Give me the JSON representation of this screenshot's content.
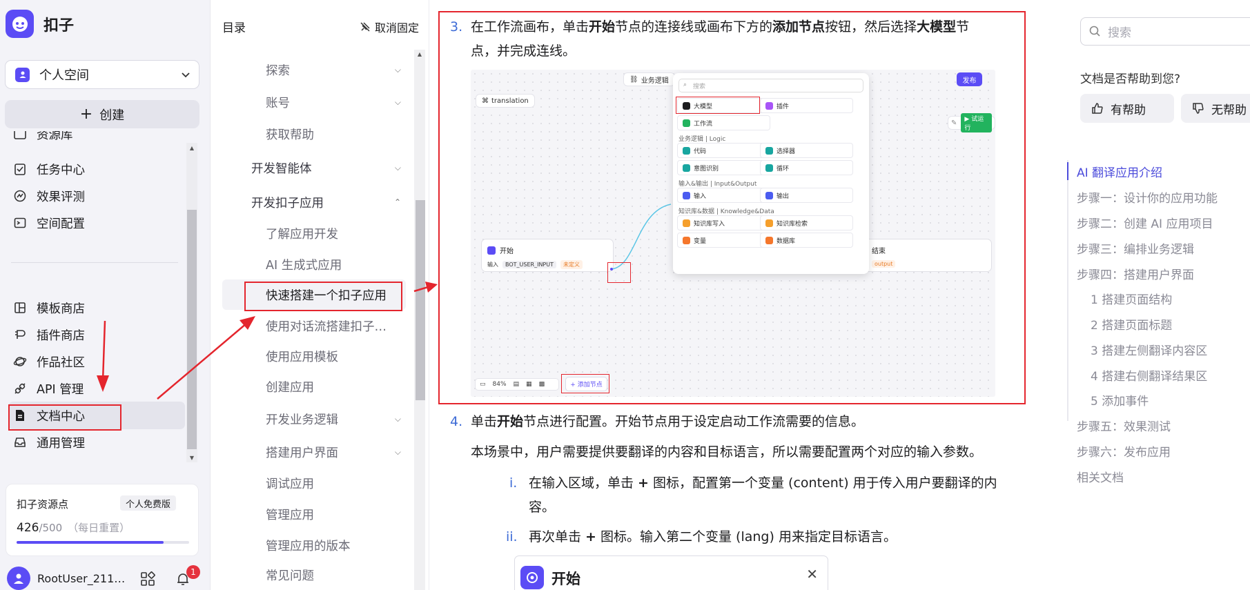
{
  "sidebar": {
    "brand": "扣子",
    "space": "个人空间",
    "create": "创建",
    "items": [
      {
        "label": "资源库",
        "icon": "resource-icon"
      },
      {
        "label": "任务中心",
        "icon": "task-icon"
      },
      {
        "label": "效果评测",
        "icon": "evaluation-icon"
      },
      {
        "label": "空间配置",
        "icon": "config-icon"
      },
      {
        "label": "模板商店",
        "icon": "template-icon"
      },
      {
        "label": "插件商店",
        "icon": "plugin-icon"
      },
      {
        "label": "作品社区",
        "icon": "community-icon"
      },
      {
        "label": "API 管理",
        "icon": "api-icon"
      },
      {
        "label": "文档中心",
        "icon": "document-icon"
      },
      {
        "label": "通用管理",
        "icon": "settings-icon"
      }
    ],
    "resource_card": {
      "title": "扣子资源点",
      "badge": "个人免费版",
      "value": "426",
      "max": "/500",
      "note": "（每日重置）",
      "fraction": 0.852
    },
    "user": {
      "name": "RootUser_2114…",
      "notifications": "1"
    }
  },
  "doc_tree": {
    "title": "目录",
    "unpin": "取消固定",
    "items": [
      {
        "label": "探索",
        "level": 2,
        "chevron": "down"
      },
      {
        "label": "账号",
        "level": 2,
        "chevron": "down"
      },
      {
        "label": "获取帮助",
        "level": 2
      },
      {
        "label": "开发智能体",
        "level": 1,
        "chevron": "down"
      },
      {
        "label": "开发扣子应用",
        "level": 1,
        "chevron": "up"
      },
      {
        "label": "了解应用开发",
        "level": 2
      },
      {
        "label": "AI 生成式应用",
        "level": 2
      },
      {
        "label": "快速搭建一个扣子应用",
        "level": 2,
        "selected": true
      },
      {
        "label": "使用对话流搭建扣子…",
        "level": 2
      },
      {
        "label": "使用应用模板",
        "level": 2
      },
      {
        "label": "创建应用",
        "level": 2
      },
      {
        "label": "开发业务逻辑",
        "level": 2,
        "chevron": "down"
      },
      {
        "label": "搭建用户界面",
        "level": 2,
        "chevron": "down"
      },
      {
        "label": "调试应用",
        "level": 2
      },
      {
        "label": "管理应用",
        "level": 2
      },
      {
        "label": "管理应用的版本",
        "level": 2
      },
      {
        "label": "常见问题",
        "level": 2
      }
    ]
  },
  "main": {
    "step3": {
      "num": "3.",
      "p1": "在工作流画布，单击",
      "b1": "开始",
      "p2": "节点的连接线或画布下方的",
      "b2": "添加节点",
      "p3": "按钮，然后选择",
      "b3": "大模型",
      "p4": "节",
      "line2": "点，并完成连线。"
    },
    "shot": {
      "biz_logic": "业务逻辑",
      "publish": "发布",
      "workflow": "translation",
      "test_run": "试运行",
      "search": "搜索",
      "start_node": "开始",
      "start_input": "输入",
      "start_var": "BOT_USER_INPUT",
      "start_tag": "未定义",
      "end_node": "结束",
      "end_tag": "output",
      "zoom": "84%",
      "add_node": "+ 添加节点",
      "items_top": [
        {
          "label": "大模型",
          "color": "#1d1d1f"
        },
        {
          "label": "插件",
          "color": "#a855f7"
        },
        {
          "label": "工作流",
          "color": "#22b35e"
        }
      ],
      "cat_logic": "业务逻辑 | Logic",
      "logic": [
        {
          "label": "代码",
          "color": "#18a6a0"
        },
        {
          "label": "选择器",
          "color": "#18a6a0"
        },
        {
          "label": "意图识别",
          "color": "#18a6a0"
        },
        {
          "label": "循环",
          "color": "#18a6a0"
        }
      ],
      "cat_io": "输入&输出 | Input&Output",
      "io": [
        {
          "label": "输入",
          "color": "#4b5cf0"
        },
        {
          "label": "输出",
          "color": "#4b5cf0"
        }
      ],
      "cat_kb": "知识库&数据 | Knowledge&Data",
      "kb": [
        {
          "label": "知识库写入",
          "color": "#f59f2c"
        },
        {
          "label": "知识库检索",
          "color": "#f59f2c"
        },
        {
          "label": "变量",
          "color": "#f5772c"
        },
        {
          "label": "数据库",
          "color": "#f5772c"
        }
      ]
    },
    "step4": {
      "num": "4.",
      "p1": "单击",
      "b1": "开始",
      "p2": "节点进行配置。开始节点用于设定启动工作流需要的信息。"
    },
    "step4_desc": "本场景中，用户需要提供要翻译的内容和目标语言，所以需要配置两个对应的输入参数。",
    "sub1": {
      "num": "i.",
      "p1": "在输入区域，单击 ",
      "b1": "+",
      "p2": " 图标，配置第一个变量 (content) 用于传入用户要翻译的内",
      "line2": "容。"
    },
    "sub2": {
      "num": "ii.",
      "p1": "再次单击 ",
      "b1": "+",
      "p2": " 图标。输入第二个变量 (lang) 用来指定目标语言。"
    },
    "start_card": {
      "label": "开始"
    }
  },
  "right": {
    "search_placeholder": "搜索",
    "help_question": "文档是否帮助到您?",
    "helpful": "有帮助",
    "not_helpful": "无帮助",
    "toc": [
      {
        "label": "AI 翻译应用介绍",
        "active": true
      },
      {
        "label": "步骤一：设计你的应用功能"
      },
      {
        "label": "步骤二：创建 AI 应用项目"
      },
      {
        "label": "步骤三：编排业务逻辑"
      },
      {
        "label": "步骤四：搭建用户界面"
      },
      {
        "label": "1 搭建页面结构",
        "indent": true
      },
      {
        "label": "2 搭建页面标题",
        "indent": true
      },
      {
        "label": "3 搭建左侧翻译内容区",
        "indent": true
      },
      {
        "label": "4 搭建右侧翻译结果区",
        "indent": true
      },
      {
        "label": "5 添加事件",
        "indent": true
      },
      {
        "label": "步骤五：效果测试"
      },
      {
        "label": "步骤六：发布应用"
      },
      {
        "label": "相关文档"
      }
    ]
  },
  "colors": {
    "accent": "#5b4cf5",
    "annotation": "#e4252d",
    "link": "#3d6bd6"
  }
}
